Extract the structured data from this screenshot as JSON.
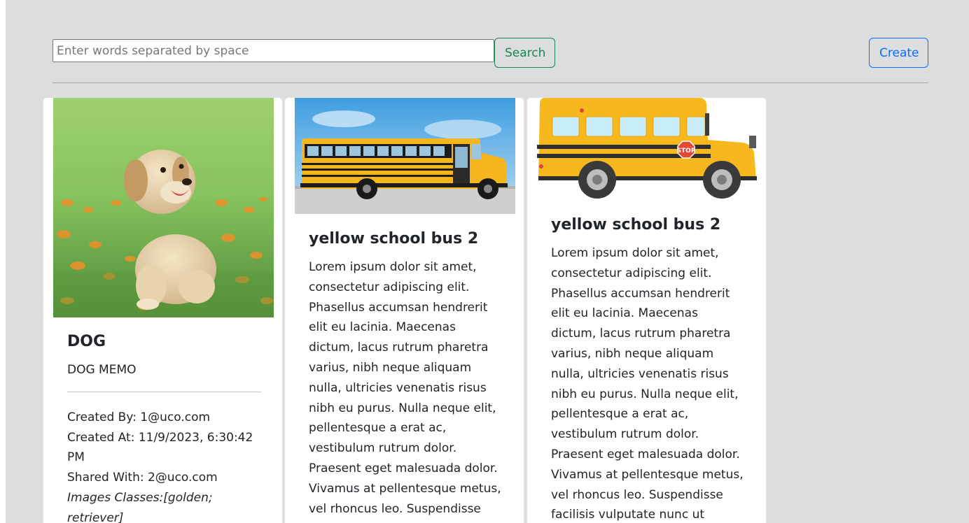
{
  "search": {
    "placeholder": "Enter words separated by space",
    "value": "",
    "button_label": "Search"
  },
  "create_label": "Create",
  "cards": [
    {
      "title": "DOG",
      "memo": "DOG MEMO",
      "created_by": "Created By: 1@uco.com",
      "created_at": "Created At: 11/9/2023, 6:30:42 PM",
      "shared_with": "Shared With: 2@uco.com",
      "image_classes": "Images Classes:[golden; retriever]",
      "image": "golden-retriever-puppy-photo"
    },
    {
      "title": "yellow school bus 2",
      "text": "Lorem ipsum dolor sit amet, consectetur adipiscing elit. Phasellus accumsan hendrerit elit eu lacinia. Maecenas dictum, lacus rutrum pharetra varius, nibh neque aliquam nulla, ultricies venenatis risus nibh eu purus. Nulla neque elit, pellentesque a erat ac, vestibulum rutrum dolor. Praesent eget malesuada dolor. Vivamus at pellentesque metus, vel rhoncus leo. Suspendisse facilisis vulputate nunc ut",
      "image": "school-bus-photo"
    },
    {
      "title": "yellow school bus 2",
      "text": "Lorem ipsum dolor sit amet, consectetur adipiscing elit. Phasellus accumsan hendrerit elit eu lacinia. Maecenas dictum, lacus rutrum pharetra varius, nibh neque aliquam nulla, ultricies venenatis risus nibh eu purus. Nulla neque elit, pellentesque a erat ac, vestibulum rutrum dolor. Praesent eget malesuada dolor. Vivamus at pellentesque metus, vel rhoncus leo. Suspendisse facilisis vulputate nunc ut",
      "image": "school-bus-illustration",
      "stop_sign_text": "STOP"
    }
  ],
  "colors": {
    "page_background": "#dcdddf",
    "search_button": "#198754",
    "create_button": "#0d6efd",
    "bus_yellow": "#f7b81d"
  }
}
